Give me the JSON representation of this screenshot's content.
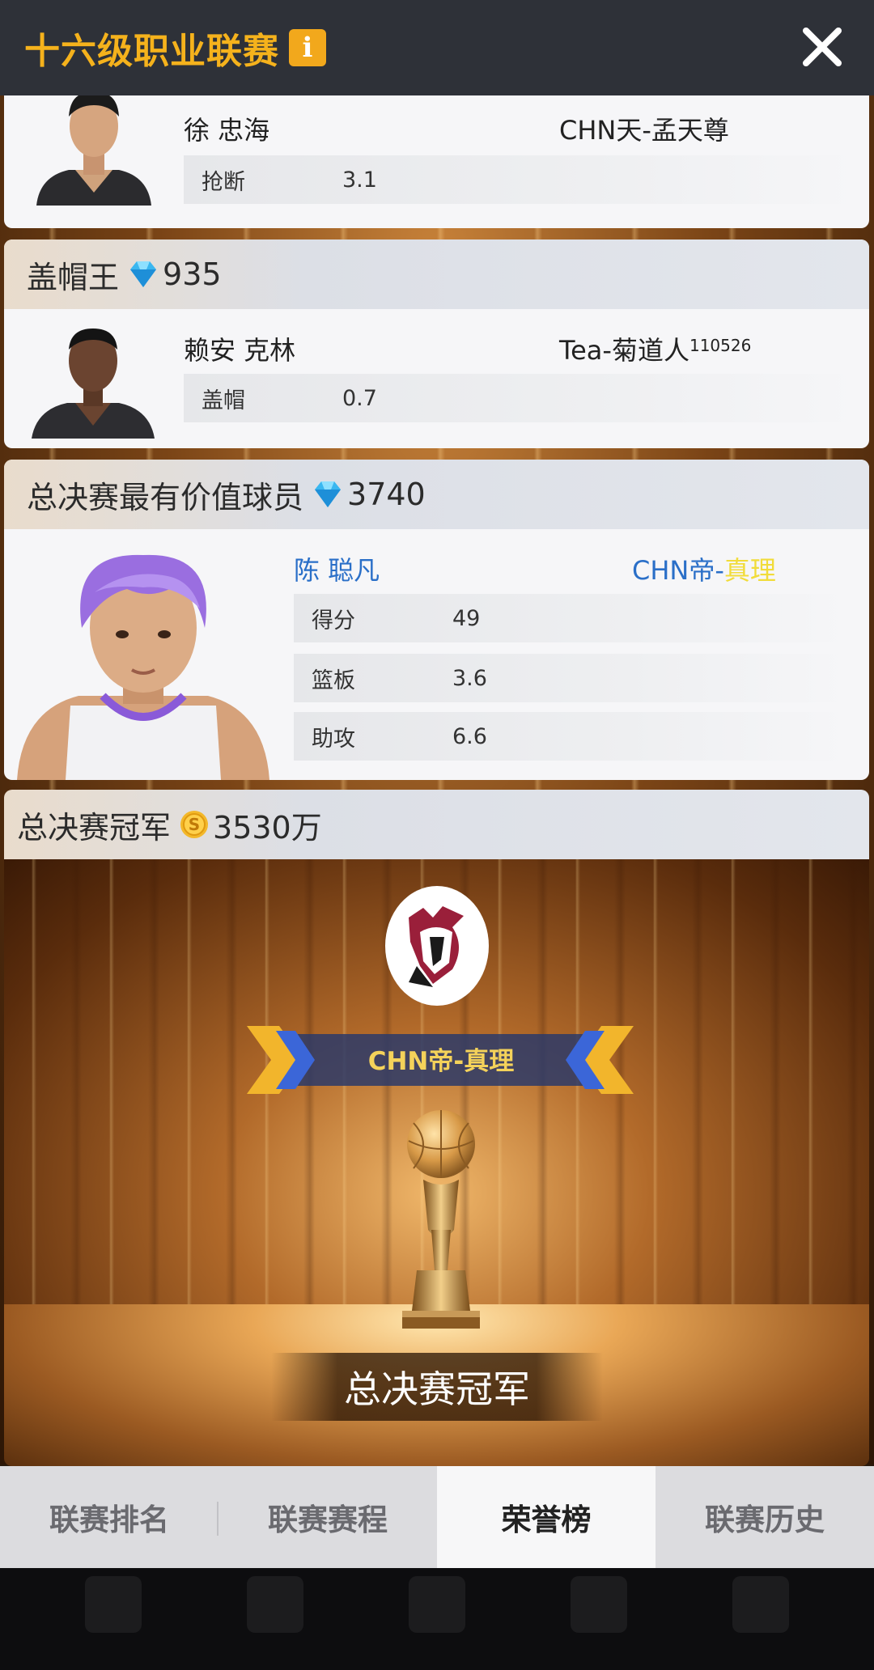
{
  "header": {
    "title": "十六级职业联赛",
    "info_icon": "i"
  },
  "steals": {
    "player_name": "徐 忠海",
    "team": "CHN天-孟天尊",
    "stat_label": "抢断",
    "stat_value": "3.1"
  },
  "blocks": {
    "title": "盖帽王",
    "reward": "935",
    "player_name": "赖安 克林",
    "team": "Tea-菊道人",
    "team_sup": "110526",
    "stat_label": "盖帽",
    "stat_value": "0.7"
  },
  "mvp": {
    "title": "总决赛最有价值球员",
    "reward": "3740",
    "player_name": "陈 聪凡",
    "team_prefix": "CHN帝-",
    "team_suffix": "真理",
    "stats": [
      {
        "label": "得分",
        "value": "49"
      },
      {
        "label": "篮板",
        "value": "3.6"
      },
      {
        "label": "助攻",
        "value": "6.6"
      }
    ]
  },
  "champion": {
    "title": "总决赛冠军",
    "reward": "3530万",
    "team_prefix": "CHN帝-",
    "team_suffix": "真理",
    "plaque": "总决赛冠军"
  },
  "tabs": [
    {
      "label": "联赛排名",
      "active": false
    },
    {
      "label": "联赛赛程",
      "active": false
    },
    {
      "label": "荣誉榜",
      "active": true
    },
    {
      "label": "联赛历史",
      "active": false
    }
  ],
  "colors": {
    "title_gold": "#f5b21c",
    "mvp_blue": "#2a6fc8",
    "mvp_team_yellow": "#f1dc3a",
    "banner_text": "#f4d25a"
  }
}
